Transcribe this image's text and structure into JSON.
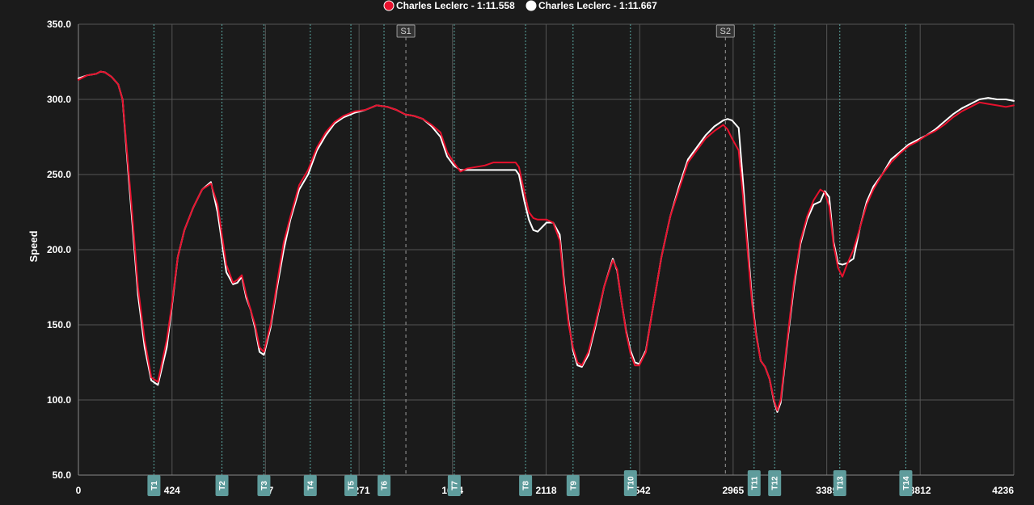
{
  "chart_data": {
    "type": "line",
    "ylabel": "Speed",
    "xlabel": "",
    "xlim": [
      0,
      4236
    ],
    "ylim": [
      50,
      350
    ],
    "y_ticks": [
      "50.0",
      "100.0",
      "150.0",
      "200.0",
      "250.0",
      "300.0",
      "350.0"
    ],
    "x_ticks": [
      {
        "value": 0,
        "label": "0"
      },
      {
        "value": 424,
        "label": "424"
      },
      {
        "value": 847,
        "label": "847"
      },
      {
        "value": 1271,
        "label": "1271"
      },
      {
        "value": 1694,
        "label": "1694"
      },
      {
        "value": 2118,
        "label": "2118"
      },
      {
        "value": 2542,
        "label": "2542"
      },
      {
        "value": 2965,
        "label": "2965"
      },
      {
        "value": 3389,
        "label": "3389"
      },
      {
        "value": 3812,
        "label": "3812"
      },
      {
        "value": 4236,
        "label": "4236"
      }
    ],
    "grid": true,
    "legend": "top-center",
    "sectors": [
      {
        "label": "S1",
        "x": 1483
      },
      {
        "label": "S2",
        "x": 2930
      }
    ],
    "turns": [
      {
        "label": "T1",
        "x": 342
      },
      {
        "label": "T2",
        "x": 650
      },
      {
        "label": "T3",
        "x": 840
      },
      {
        "label": "T4",
        "x": 1050
      },
      {
        "label": "T5",
        "x": 1234
      },
      {
        "label": "T6",
        "x": 1384
      },
      {
        "label": "T7",
        "x": 1702
      },
      {
        "label": "T8",
        "x": 2025
      },
      {
        "label": "T9",
        "x": 2240
      },
      {
        "label": "T10",
        "x": 2500
      },
      {
        "label": "T11",
        "x": 3060
      },
      {
        "label": "T12",
        "x": 3153
      },
      {
        "label": "T13",
        "x": 3448
      },
      {
        "label": "T14",
        "x": 3747
      }
    ],
    "series": [
      {
        "name": "Charles Leclerc - 1:11.558",
        "color": "#e8112d",
        "points": [
          [
            0,
            313
          ],
          [
            40,
            316
          ],
          [
            80,
            317
          ],
          [
            100,
            318.5
          ],
          [
            120,
            318
          ],
          [
            150,
            315
          ],
          [
            180,
            310
          ],
          [
            200,
            300
          ],
          [
            220,
            265
          ],
          [
            240,
            230
          ],
          [
            270,
            175
          ],
          [
            300,
            140
          ],
          [
            330,
            115
          ],
          [
            360,
            112
          ],
          [
            400,
            140
          ],
          [
            420,
            160
          ],
          [
            450,
            195
          ],
          [
            480,
            213
          ],
          [
            520,
            228
          ],
          [
            560,
            240
          ],
          [
            600,
            244
          ],
          [
            630,
            230
          ],
          [
            650,
            210
          ],
          [
            670,
            190
          ],
          [
            700,
            178
          ],
          [
            720,
            180
          ],
          [
            740,
            183
          ],
          [
            760,
            170
          ],
          [
            780,
            160
          ],
          [
            800,
            150
          ],
          [
            820,
            135
          ],
          [
            840,
            132
          ],
          [
            870,
            150
          ],
          [
            900,
            178
          ],
          [
            930,
            205
          ],
          [
            960,
            222
          ],
          [
            1000,
            243
          ],
          [
            1040,
            253
          ],
          [
            1080,
            268
          ],
          [
            1120,
            278
          ],
          [
            1160,
            285
          ],
          [
            1200,
            289
          ],
          [
            1250,
            292
          ],
          [
            1300,
            293
          ],
          [
            1350,
            296
          ],
          [
            1400,
            295
          ],
          [
            1440,
            293
          ],
          [
            1480,
            290
          ],
          [
            1520,
            289
          ],
          [
            1560,
            287
          ],
          [
            1600,
            283
          ],
          [
            1640,
            278
          ],
          [
            1670,
            265
          ],
          [
            1700,
            258
          ],
          [
            1730,
            252
          ],
          [
            1760,
            254
          ],
          [
            1800,
            255
          ],
          [
            1840,
            256
          ],
          [
            1880,
            258
          ],
          [
            1920,
            258
          ],
          [
            1950,
            258
          ],
          [
            1980,
            258
          ],
          [
            1995,
            255
          ],
          [
            2020,
            238
          ],
          [
            2040,
            225
          ],
          [
            2060,
            221
          ],
          [
            2080,
            220
          ],
          [
            2120,
            220
          ],
          [
            2150,
            218
          ],
          [
            2180,
            206
          ],
          [
            2200,
            175
          ],
          [
            2220,
            150
          ],
          [
            2240,
            135
          ],
          [
            2260,
            125
          ],
          [
            2280,
            123
          ],
          [
            2310,
            132
          ],
          [
            2340,
            150
          ],
          [
            2380,
            175
          ],
          [
            2420,
            193
          ],
          [
            2440,
            187
          ],
          [
            2460,
            165
          ],
          [
            2480,
            145
          ],
          [
            2500,
            131
          ],
          [
            2520,
            123
          ],
          [
            2540,
            123
          ],
          [
            2570,
            132
          ],
          [
            2600,
            160
          ],
          [
            2640,
            195
          ],
          [
            2680,
            222
          ],
          [
            2720,
            240
          ],
          [
            2760,
            258
          ],
          [
            2800,
            266
          ],
          [
            2840,
            274
          ],
          [
            2880,
            279
          ],
          [
            2920,
            283
          ],
          [
            2940,
            280
          ],
          [
            2960,
            274
          ],
          [
            2990,
            266
          ],
          [
            3010,
            235
          ],
          [
            3030,
            200
          ],
          [
            3050,
            165
          ],
          [
            3070,
            142
          ],
          [
            3090,
            126
          ],
          [
            3110,
            122
          ],
          [
            3130,
            114
          ],
          [
            3150,
            100
          ],
          [
            3165,
            93
          ],
          [
            3180,
            100
          ],
          [
            3210,
            140
          ],
          [
            3240,
            178
          ],
          [
            3270,
            206
          ],
          [
            3300,
            222
          ],
          [
            3330,
            233
          ],
          [
            3360,
            240
          ],
          [
            3380,
            238
          ],
          [
            3400,
            229
          ],
          [
            3420,
            203
          ],
          [
            3440,
            188
          ],
          [
            3460,
            182
          ],
          [
            3480,
            190
          ],
          [
            3510,
            200
          ],
          [
            3540,
            215
          ],
          [
            3570,
            230
          ],
          [
            3600,
            240
          ],
          [
            3640,
            250
          ],
          [
            3680,
            258
          ],
          [
            3720,
            264
          ],
          [
            3760,
            269
          ],
          [
            3800,
            272
          ],
          [
            3840,
            276
          ],
          [
            3880,
            279
          ],
          [
            3920,
            283
          ],
          [
            3960,
            288
          ],
          [
            4000,
            292
          ],
          [
            4040,
            295
          ],
          [
            4080,
            298
          ],
          [
            4120,
            297
          ],
          [
            4160,
            296
          ],
          [
            4200,
            295
          ],
          [
            4236,
            296
          ]
        ]
      },
      {
        "name": "Charles Leclerc - 1:11.667",
        "color": "#ffffff",
        "points": [
          [
            0,
            314
          ],
          [
            40,
            316
          ],
          [
            80,
            317
          ],
          [
            100,
            318.5
          ],
          [
            120,
            318
          ],
          [
            150,
            315
          ],
          [
            180,
            310
          ],
          [
            200,
            300
          ],
          [
            220,
            262
          ],
          [
            240,
            225
          ],
          [
            270,
            170
          ],
          [
            300,
            135
          ],
          [
            330,
            113
          ],
          [
            360,
            110
          ],
          [
            400,
            135
          ],
          [
            420,
            158
          ],
          [
            450,
            195
          ],
          [
            480,
            213
          ],
          [
            520,
            228
          ],
          [
            560,
            240
          ],
          [
            600,
            245
          ],
          [
            630,
            225
          ],
          [
            650,
            205
          ],
          [
            670,
            185
          ],
          [
            700,
            177
          ],
          [
            720,
            178
          ],
          [
            740,
            182
          ],
          [
            760,
            168
          ],
          [
            780,
            160
          ],
          [
            800,
            148
          ],
          [
            820,
            132
          ],
          [
            840,
            130
          ],
          [
            870,
            148
          ],
          [
            900,
            175
          ],
          [
            930,
            200
          ],
          [
            960,
            220
          ],
          [
            1000,
            240
          ],
          [
            1040,
            250
          ],
          [
            1080,
            266
          ],
          [
            1120,
            276
          ],
          [
            1160,
            284
          ],
          [
            1200,
            288
          ],
          [
            1250,
            291
          ],
          [
            1300,
            293
          ],
          [
            1350,
            296
          ],
          [
            1400,
            295
          ],
          [
            1440,
            293
          ],
          [
            1480,
            290
          ],
          [
            1520,
            289
          ],
          [
            1560,
            287
          ],
          [
            1600,
            282
          ],
          [
            1640,
            275
          ],
          [
            1670,
            262
          ],
          [
            1700,
            256
          ],
          [
            1730,
            253
          ],
          [
            1760,
            253
          ],
          [
            1800,
            253
          ],
          [
            1840,
            253
          ],
          [
            1880,
            253
          ],
          [
            1920,
            253
          ],
          [
            1950,
            253
          ],
          [
            1980,
            253
          ],
          [
            1995,
            250
          ],
          [
            2020,
            232
          ],
          [
            2040,
            220
          ],
          [
            2060,
            213
          ],
          [
            2080,
            212
          ],
          [
            2120,
            218
          ],
          [
            2150,
            218
          ],
          [
            2180,
            210
          ],
          [
            2200,
            178
          ],
          [
            2220,
            152
          ],
          [
            2240,
            133
          ],
          [
            2260,
            123
          ],
          [
            2280,
            122
          ],
          [
            2310,
            130
          ],
          [
            2340,
            148
          ],
          [
            2380,
            175
          ],
          [
            2420,
            194
          ],
          [
            2440,
            186
          ],
          [
            2460,
            165
          ],
          [
            2480,
            146
          ],
          [
            2500,
            133
          ],
          [
            2520,
            125
          ],
          [
            2540,
            124
          ],
          [
            2570,
            133
          ],
          [
            2600,
            160
          ],
          [
            2640,
            195
          ],
          [
            2680,
            222
          ],
          [
            2720,
            242
          ],
          [
            2760,
            260
          ],
          [
            2800,
            268
          ],
          [
            2840,
            276
          ],
          [
            2880,
            282
          ],
          [
            2920,
            286
          ],
          [
            2940,
            287
          ],
          [
            2960,
            286
          ],
          [
            2990,
            281
          ],
          [
            3010,
            245
          ],
          [
            3030,
            205
          ],
          [
            3050,
            168
          ],
          [
            3070,
            143
          ],
          [
            3090,
            126
          ],
          [
            3110,
            122
          ],
          [
            3130,
            114
          ],
          [
            3150,
            99
          ],
          [
            3165,
            92
          ],
          [
            3180,
            98
          ],
          [
            3210,
            138
          ],
          [
            3240,
            175
          ],
          [
            3270,
            204
          ],
          [
            3300,
            220
          ],
          [
            3330,
            230
          ],
          [
            3360,
            232
          ],
          [
            3380,
            239
          ],
          [
            3400,
            235
          ],
          [
            3420,
            205
          ],
          [
            3440,
            191
          ],
          [
            3460,
            190
          ],
          [
            3480,
            191
          ],
          [
            3510,
            194
          ],
          [
            3540,
            215
          ],
          [
            3570,
            232
          ],
          [
            3600,
            242
          ],
          [
            3640,
            250
          ],
          [
            3680,
            260
          ],
          [
            3720,
            265
          ],
          [
            3760,
            270
          ],
          [
            3800,
            273
          ],
          [
            3840,
            276
          ],
          [
            3880,
            280
          ],
          [
            3920,
            285
          ],
          [
            3960,
            290
          ],
          [
            4000,
            294
          ],
          [
            4040,
            297
          ],
          [
            4080,
            300
          ],
          [
            4120,
            301
          ],
          [
            4160,
            300
          ],
          [
            4200,
            300
          ],
          [
            4236,
            299
          ]
        ]
      }
    ]
  }
}
